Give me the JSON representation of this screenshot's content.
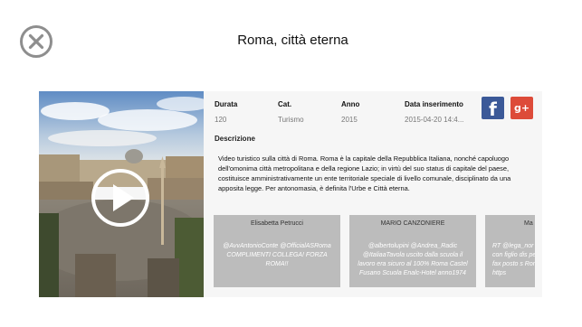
{
  "header": {
    "title": "Roma, città eterna"
  },
  "video": {
    "meta": [
      {
        "label": "Durata",
        "value": "120"
      },
      {
        "label": "Cat.",
        "value": "Turismo"
      },
      {
        "label": "Anno",
        "value": "2015"
      },
      {
        "label": "Data inserimento",
        "value": "2015-04-20 14:4..."
      }
    ],
    "description_label": "Descrizione",
    "description": "Video turistico sulla città di Roma. Roma è la capitale della Repubblica Italiana, nonché capoluogo dell'omonima città metropolitana e della regione Lazio; in virtù del suo status di capitale del paese, costituisce amministrativamente un ente territoriale speciale di livello comunale, disciplinato da una apposita legge. Per antonomasia, è definita l'Urbe e Città eterna."
  },
  "share": {
    "facebook_glyph": "f",
    "googleplus_glyph": "g+"
  },
  "comments": [
    {
      "author": "Elisabetta Petrucci",
      "text": "@AvvAntonioConte @OfficialASRoma COMPLIMENTI COLLEGA! FORZA ROMA!!"
    },
    {
      "author": "MARIO CANZONIERE",
      "text": "@albertolupini @Andrea_Radic @ItaliaaTavola uscito dalla scuola il lavoro era sicuro al 100% Roma Castel Fusano Scuola Enalc-Hotel anno1974"
    },
    {
      "author": "Ma",
      "text": "RT @lega_nor con figlio dis per fax posto s Roma https"
    }
  ],
  "colors": {
    "facebook": "#3b5998",
    "googleplus": "#dd4b39",
    "comment_card": "#bcbcbc",
    "card_bg": "#f6f6f6"
  },
  "icons": [
    "close-icon",
    "play-icon",
    "facebook-icon",
    "google-plus-icon"
  ]
}
